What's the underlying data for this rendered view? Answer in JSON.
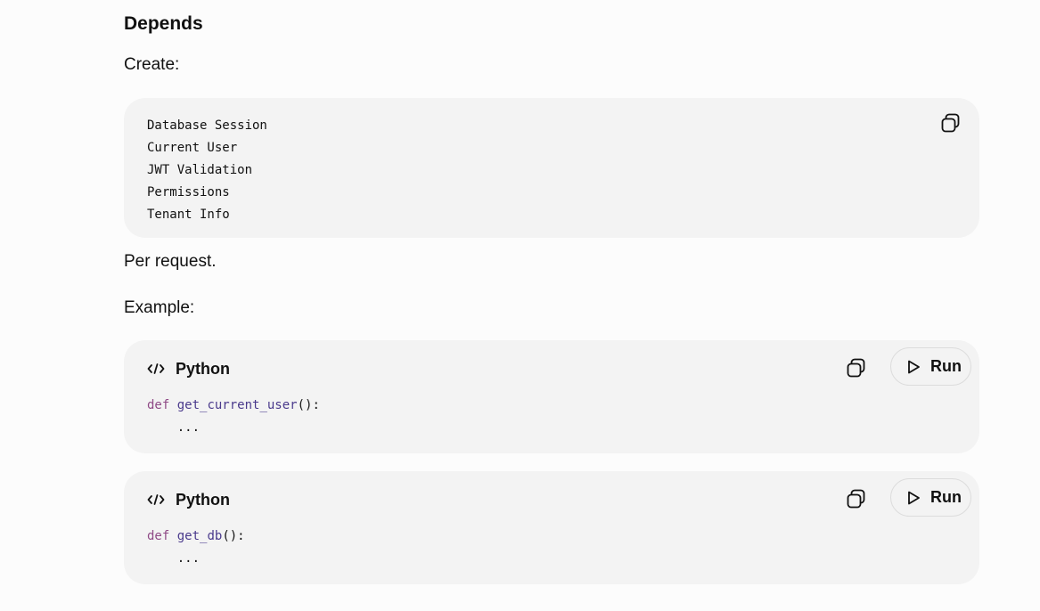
{
  "heading": "Depends",
  "intro": "Create:",
  "list_block": {
    "lines": [
      "Database Session",
      "Current User",
      "JWT Validation",
      "Permissions",
      "Tenant Info"
    ],
    "copy_icon": "copy-icon"
  },
  "per_request": "Per request.",
  "example_label": "Example:",
  "code_blocks": [
    {
      "language": "Python",
      "run_label": "Run",
      "keyword": "def",
      "function": "get_current_user",
      "signature_rest": "():",
      "body": "    ..."
    },
    {
      "language": "Python",
      "run_label": "Run",
      "keyword": "def",
      "function": "get_db",
      "signature_rest": "():",
      "body": "    ..."
    }
  ],
  "colors": {
    "background": "#fcfcfc",
    "block_background": "#f3f3f3",
    "keyword": "#8f4a86",
    "function": "#4a3a8c"
  }
}
